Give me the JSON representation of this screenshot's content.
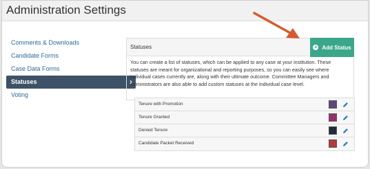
{
  "header": {
    "title": "Administration Settings"
  },
  "sidebar": {
    "items": [
      {
        "label": "Comments & Downloads"
      },
      {
        "label": "Candidate Forms"
      },
      {
        "label": "Case Data Forms"
      },
      {
        "label": "Statuses",
        "active": true
      },
      {
        "label": "Voting"
      }
    ]
  },
  "panel": {
    "title": "Statuses",
    "add_button": "Add Status",
    "description": "You can create a list of statuses, which can be applied to any case at your institution. These statuses are meant for organizational and reporting purposes, so you can easily see where individual cases currently are, along with their ultimate outcome. Committee Managers and Administrators are also able to add custom statuses at the individual case level."
  },
  "statuses": [
    {
      "label": "Tenure with Promotion",
      "color": "#5a4a7a"
    },
    {
      "label": "Tenure Granted",
      "color": "#9a2f6a"
    },
    {
      "label": "Denied Tenure",
      "color": "#1f2a3a"
    },
    {
      "label": "Candidate Packet Received",
      "color": "#b33a3a"
    }
  ],
  "colors": {
    "accent": "#3aa78a",
    "sidebar_active": "#3d5266",
    "link": "#2a6a9b",
    "arrow": "#d95a2b"
  },
  "icons": {
    "arrow": "annotation-arrow-icon",
    "chevron": "chevron-right-icon",
    "plus": "plus-circle-icon",
    "edit": "pencil-icon"
  }
}
